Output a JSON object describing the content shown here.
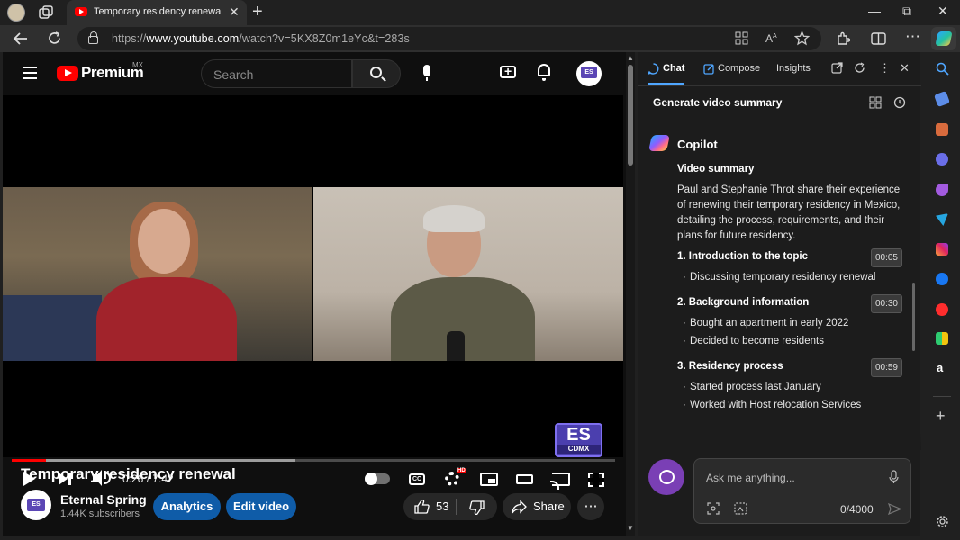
{
  "browser": {
    "tab_title": "Temporary residency renewal - YouTube",
    "tab_close": "✕",
    "new_tab": "+",
    "window_controls": {
      "minimize": "—",
      "restore": "⧉",
      "close": "✕"
    },
    "url_prefix": "https://",
    "url_domain": "www.youtube.com",
    "url_path": "/watch?v=5KX8Z0m1eYc&t=283s",
    "icons": [
      "back-arrow-icon",
      "refresh-icon",
      "lock-icon",
      "apps-icon",
      "read-aloud-icon",
      "favorite-star-icon",
      "extensions-icon",
      "split-screen-icon",
      "more-icon",
      "copilot-icon"
    ]
  },
  "youtube": {
    "brand": "Premium",
    "region": "MX",
    "search_placeholder": "Search",
    "player": {
      "time_current": "0:26",
      "time_total": "7:42",
      "progress_played": 0.056,
      "progress_buffered": 0.47,
      "cc_label": "CC",
      "hd_badge": "HD",
      "watermark_top": "ES",
      "watermark_bottom": "CDMX"
    },
    "video_title": "Temporary residency renewal",
    "channel_name": "Eternal Spring",
    "subscribers": "1.44K subscribers",
    "avatar_text": "ES",
    "analytics_label": "Analytics",
    "edit_label": "Edit video",
    "likes": "53",
    "share_label": "Share",
    "more_label": "⋯"
  },
  "copilot": {
    "tabs": [
      "Chat",
      "Compose",
      "Insights"
    ],
    "summary_title": "Generate video summary",
    "assistant_name": "Copilot",
    "heading": "Video summary",
    "intro": "Paul and Stephanie Throt share their experience of renewing their temporary residency in Mexico, detailing the process, requirements, and their plans for future residency.",
    "sections": [
      {
        "title": "1.  Introduction to the topic",
        "time": "00:05",
        "bullets": [
          "Discussing temporary residency renewal"
        ]
      },
      {
        "title": "2.  Background information",
        "time": "00:30",
        "bullets": [
          "Bought an apartment in early 2022",
          "Decided to become residents"
        ]
      },
      {
        "title": "3.  Residency process",
        "time": "00:59",
        "bullets": [
          "Started process last January",
          "Worked with Host relocation Services"
        ]
      }
    ],
    "input_placeholder": "Ask me anything...",
    "char_count": "0/4000"
  },
  "colors": {
    "accent": "#0f5ca8",
    "youtube_red": "#ff0000",
    "copilot_tab": "#4fa6ff"
  }
}
